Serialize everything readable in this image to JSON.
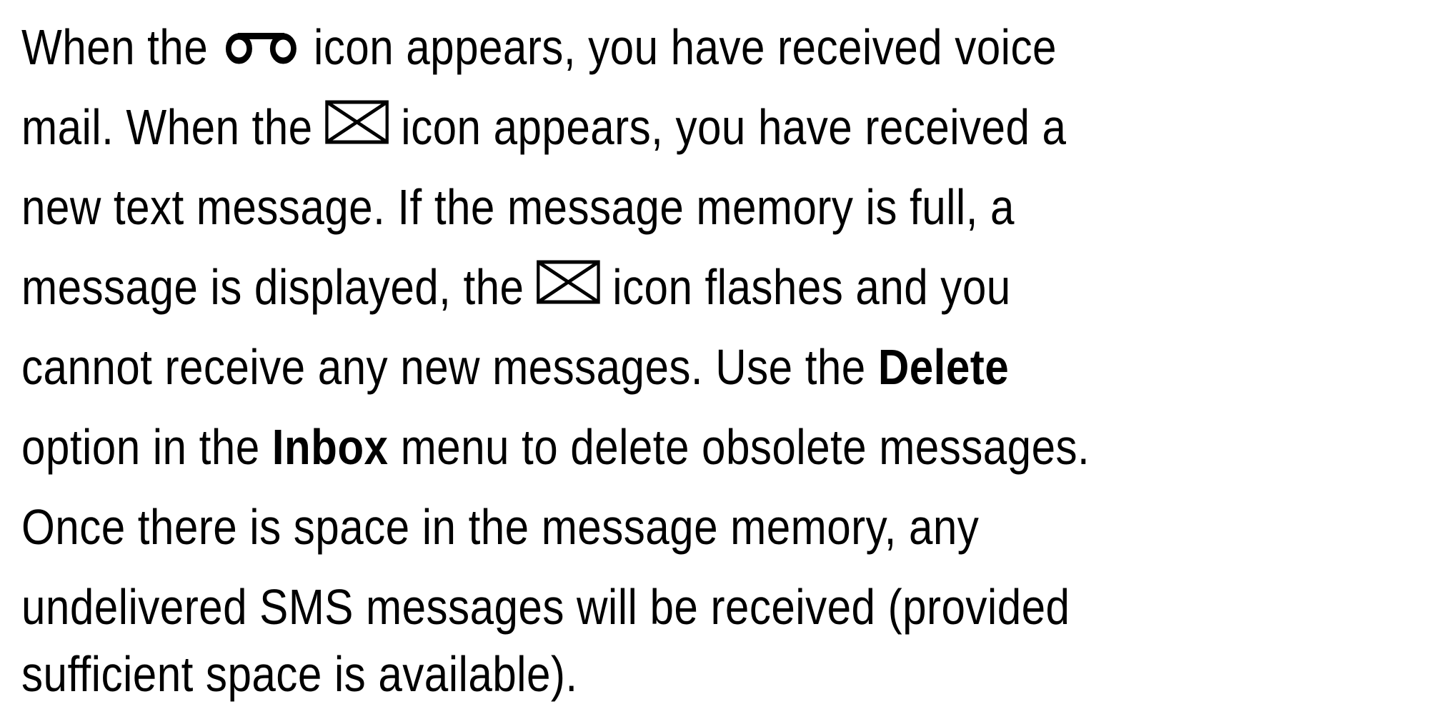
{
  "paragraph": {
    "line1": {
      "a": "When the ",
      "b": " icon appears, you have received voice"
    },
    "line2": {
      "a": "mail. When the ",
      "b": " icon appears, you have received a"
    },
    "line3": "new text message. If the message memory is full, a",
    "line4": {
      "a": "message is displayed, the ",
      "b": " icon flashes and you"
    },
    "line5": {
      "a": "cannot receive any new messages. Use the ",
      "bold": "Delete"
    },
    "line6": {
      "a": "option in the ",
      "bold": "Inbox",
      "b": " menu to delete obsolete messages."
    },
    "line7": "Once there is space in the message memory, any",
    "line8": "undelivered SMS messages will be received (provided",
    "line9": "sufficient space is available)."
  },
  "icons": {
    "voicemail": "voicemail-icon",
    "message": "envelope-icon"
  },
  "colors": {
    "text": "#000000",
    "background": "#ffffff"
  }
}
